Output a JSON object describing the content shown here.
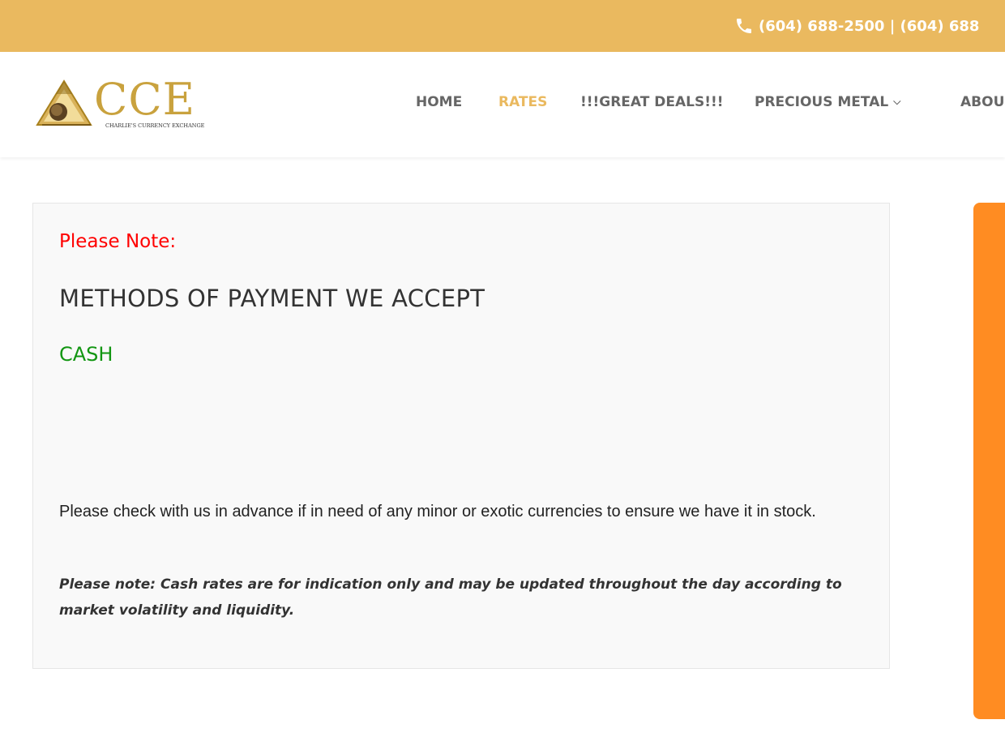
{
  "top_bar": {
    "phone_icon": "phone-icon",
    "contact_text": "(604) 688-2500 | (604) 688"
  },
  "header": {
    "logo": {
      "mark_icon": "triangle-globe-logo-icon",
      "text": "CCE",
      "subtitle": "CHARLIE'S CURRENCY EXCHANGE"
    },
    "nav": [
      {
        "label": "HOME",
        "active": false
      },
      {
        "label": "RATES",
        "active": true
      },
      {
        "label": "!!!GREAT DEALS!!!",
        "active": false
      },
      {
        "label": "PRECIOUS METAL",
        "active": false,
        "has_dropdown": true
      },
      {
        "label": "ABOU",
        "active": false
      }
    ]
  },
  "main": {
    "please_note": "Please Note:",
    "methods_title": "METHODS OF PAYMENT WE ACCEPT",
    "cash_label": "CASH",
    "check_text": "Please check with us in advance if in need of any minor or exotic currencies to ensure we have it in stock.",
    "disclaimer": "Please note: Cash rates are for indication only and may be updated throughout the day according to market volatility and liquidity."
  },
  "colors": {
    "top_bar": "#eab95f",
    "accent_nav": "#eab95f",
    "note_red": "#ff0000",
    "cash_green": "#129612",
    "side_panel": "#ff8c22"
  }
}
